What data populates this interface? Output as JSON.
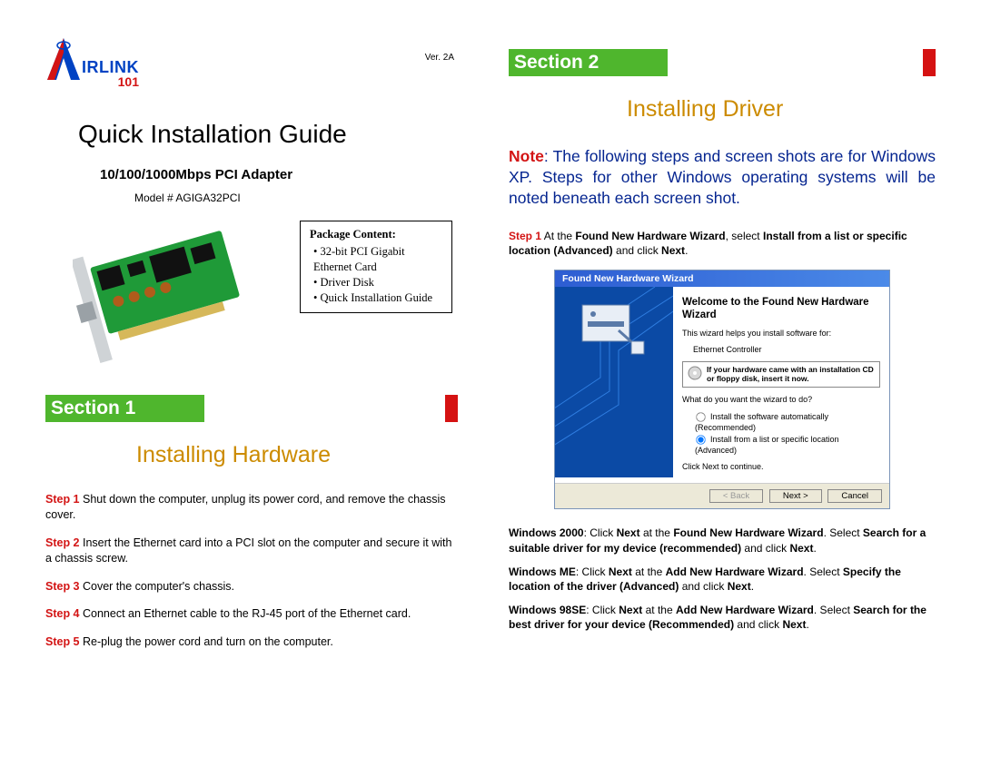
{
  "version": "Ver. 2A",
  "logo": {
    "irlink": "IRLINK",
    "num": "101"
  },
  "left": {
    "title": "Quick Installation Guide",
    "subtitle": "10/100/1000Mbps PCI Adapter",
    "model": "Model # AGIGA32PCI",
    "package": {
      "title": "Package Content:",
      "items": [
        "32-bit PCI Gigabit Ethernet Card",
        "Driver Disk",
        "Quick Installation Guide"
      ]
    },
    "section_label": "Section 1",
    "subhead": "Installing Hardware",
    "steps": [
      {
        "label": "Step 1",
        "text": " Shut down the computer, unplug its power cord, and remove the chassis cover."
      },
      {
        "label": "Step 2",
        "text": " Insert the Ethernet card into a PCI slot on the computer and secure it with a chassis screw."
      },
      {
        "label": "Step 3",
        "text": " Cover the computer's chassis."
      },
      {
        "label": "Step 4",
        "text": " Connect an Ethernet cable to the RJ-45 port of the Ethernet card."
      },
      {
        "label": "Step 5",
        "text": " Re-plug the power cord and turn on the computer."
      }
    ]
  },
  "right": {
    "section_label": "Section 2",
    "subhead": "Installing Driver",
    "note_label": "Note",
    "note_text": ": The following steps and screen shots are for Windows XP. Steps for other Windows operating systems will be noted beneath each screen shot.",
    "step1": {
      "label": "Step 1",
      "pre": " At the ",
      "b1": "Found New Hardware Wizard",
      "mid": ", select ",
      "b2": "Install from a list or specific location (Advanced)",
      "post": " and click ",
      "b3": "Next",
      "end": "."
    },
    "wizard": {
      "title": "Found New Hardware Wizard",
      "welcome": "Welcome to the Found New Hardware Wizard",
      "helps": "This wizard helps you install software for:",
      "device": "Ethernet Controller",
      "cd_note_b": "If your hardware came with an installation CD or floppy disk, insert it now.",
      "question": "What do you want the wizard to do?",
      "opt1": "Install the software automatically (Recommended)",
      "opt2": "Install from a list or specific location (Advanced)",
      "continue": "Click Next to continue.",
      "btn_back": "< Back",
      "btn_next": "Next >",
      "btn_cancel": "Cancel"
    },
    "os_notes": [
      {
        "os": "Windows 2000",
        "t1": ": Click ",
        "b1": "Next",
        "t2": " at the ",
        "b2": "Found New Hardware Wizard",
        "t3": ". Select ",
        "b3": "Search for a suitable driver for my device (recommended)",
        "t4": " and click ",
        "b4": "Next",
        "t5": "."
      },
      {
        "os": "Windows ME",
        "t1": ": Click ",
        "b1": "Next",
        "t2": " at the ",
        "b2": "Add New Hardware Wizard",
        "t3": ". Select ",
        "b3": "Specify the location of the driver (Advanced)",
        "t4": " and click ",
        "b4": "Next",
        "t5": "."
      },
      {
        "os": "Windows 98SE",
        "t1": ": Click ",
        "b1": "Next",
        "t2": " at the ",
        "b2": "Add New Hardware Wizard",
        "t3": ". Select ",
        "b3": "Search for the best driver for your device (Recommended)",
        "t4": " and click ",
        "b4": "Next",
        "t5": "."
      }
    ]
  }
}
